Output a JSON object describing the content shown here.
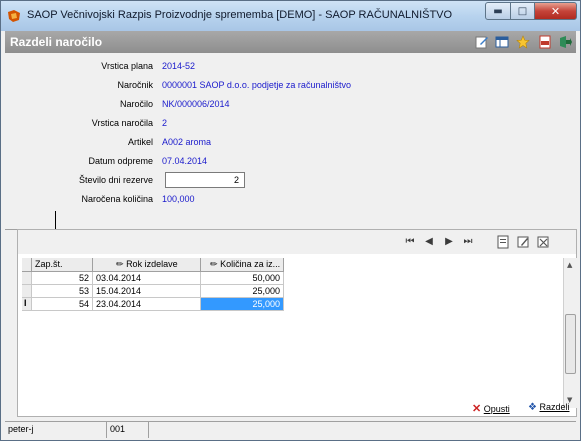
{
  "window": {
    "title": "SAOP   Večnivojski Razpis Proizvodnje sprememba [DEMO] - SAOP RAČUNALNIŠTVO"
  },
  "header": {
    "title": "Razdeli naročilo"
  },
  "form": {
    "fields": [
      {
        "label": "Vrstica plana",
        "value": "2014-52"
      },
      {
        "label": "Naročnik",
        "value": "0000001 SAOP d.o.o. podjetje za računalništvo"
      },
      {
        "label": "Naročilo",
        "value": "NK/000006/2014"
      },
      {
        "label": "Vrstica naročila",
        "value": "2"
      },
      {
        "label": "Artikel",
        "value": "A002 aroma"
      },
      {
        "label": "Datum odpreme",
        "value": "07.04.2014"
      }
    ],
    "reserve_days": {
      "label": "Število dni rezerve",
      "value": "2"
    },
    "ordered_qty": {
      "label": "Naročena količina",
      "value": "100,000"
    }
  },
  "grid": {
    "columns": [
      "Zap.št.",
      "Rok izdelave",
      "Količina za iz..."
    ],
    "rows": [
      {
        "num": "52",
        "date": "03.04.2014",
        "qty": "50,000"
      },
      {
        "num": "53",
        "date": "15.04.2014",
        "qty": "25,000"
      },
      {
        "num": "54",
        "date": "23.04.2014",
        "qty": "25,000"
      }
    ]
  },
  "actions": {
    "cancel": "Opusti",
    "split": "Razdeli"
  },
  "status": {
    "user": "peter-j",
    "code": "001"
  },
  "colors": {
    "accent": "#3399ff",
    "value_text": "#1a1acc",
    "header_band": "#999999"
  }
}
